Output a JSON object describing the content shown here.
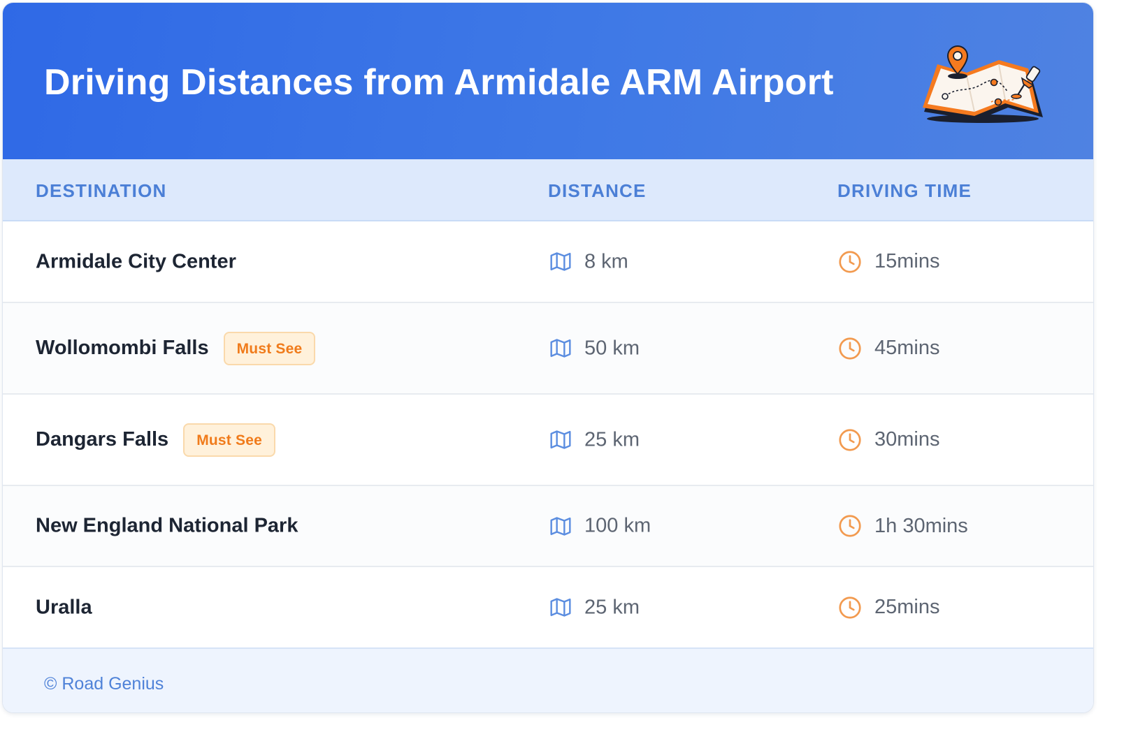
{
  "header": {
    "title": "Driving Distances from Armidale ARM Airport",
    "illustration_icon": "map-with-pins-icon"
  },
  "table": {
    "columns": [
      "DESTINATION",
      "DISTANCE",
      "DRIVING TIME"
    ],
    "distance_icon": "map-icon",
    "time_icon": "clock-icon",
    "rows": [
      {
        "destination": "Armidale City Center",
        "badge": "",
        "distance": "8 km",
        "time": "15mins"
      },
      {
        "destination": "Wollomombi Falls",
        "badge": "Must See",
        "distance": "50 km",
        "time": "45mins"
      },
      {
        "destination": "Dangars Falls",
        "badge": "Must See",
        "distance": "25 km",
        "time": "30mins"
      },
      {
        "destination": "New England National Park",
        "badge": "",
        "distance": "100 km",
        "time": "1h 30mins"
      },
      {
        "destination": "Uralla",
        "badge": "",
        "distance": "25 km",
        "time": "25mins"
      }
    ]
  },
  "footer": {
    "credit": "© Road Genius"
  },
  "colors": {
    "header_gradient_start": "#2f69e6",
    "header_gradient_end": "#4f82e2",
    "column_header_bg": "#dde9fc",
    "column_header_text": "#4b7fd6",
    "badge_bg": "#fff1db",
    "badge_text": "#f07b1b",
    "distance_icon": "#5b8de0",
    "time_icon": "#f29a4f",
    "footer_bg": "#eef4fe",
    "footer_text": "#4f82d8"
  }
}
